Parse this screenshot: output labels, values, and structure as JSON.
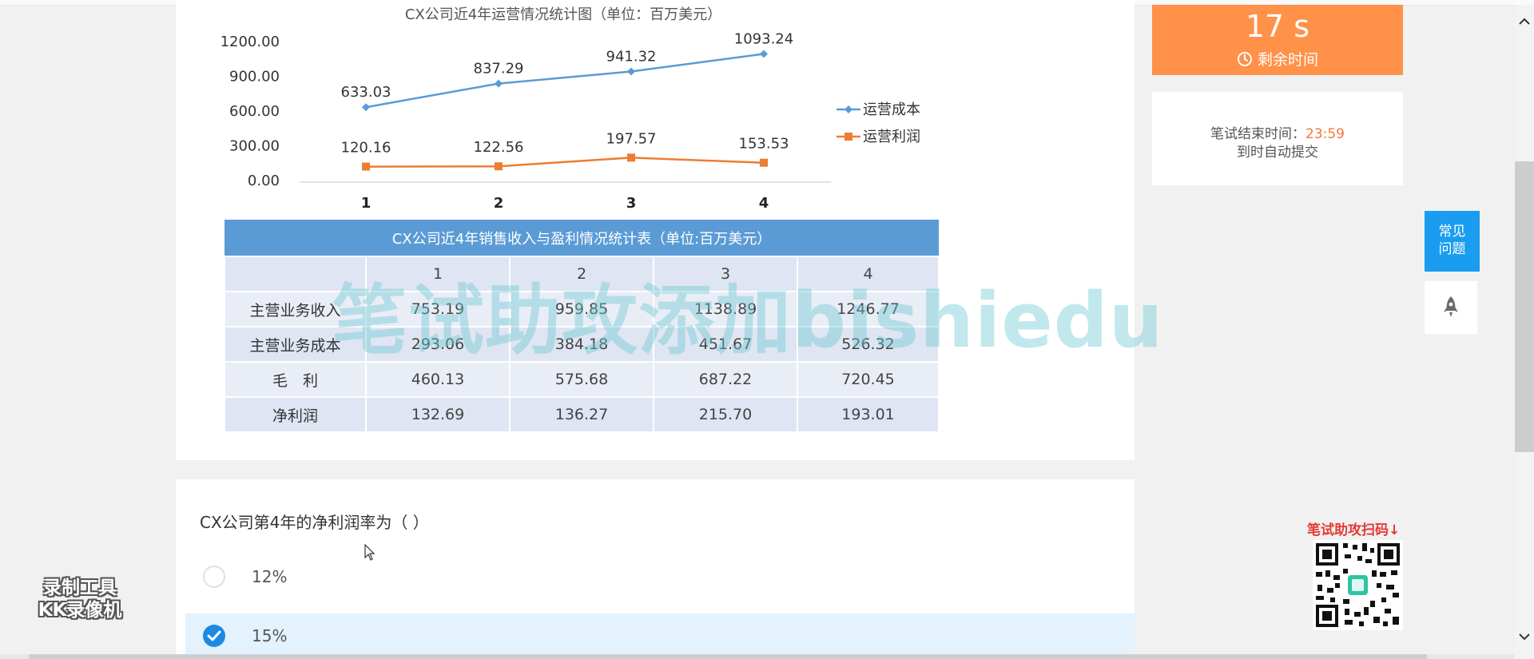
{
  "chart_data": {
    "type": "line",
    "title": "CX公司近4年运营情况统计图（单位：百万美元）",
    "categories": [
      "1",
      "2",
      "3",
      "4"
    ],
    "y_ticks": [
      "1200.00",
      "900.00",
      "600.00",
      "300.00",
      "0.00"
    ],
    "ylim": [
      0,
      1200
    ],
    "series": [
      {
        "name": "运营成本",
        "values": [
          633.03,
          837.29,
          941.32,
          1093.24
        ],
        "labels": [
          "633.03",
          "837.29",
          "941.32",
          "1093.24"
        ],
        "color": "#5b9bd5",
        "marker": "diamond"
      },
      {
        "name": "运营利润",
        "values": [
          120.16,
          122.56,
          197.57,
          153.53
        ],
        "labels": [
          "120.16",
          "122.56",
          "197.57",
          "153.53"
        ],
        "color": "#ed7d31",
        "marker": "square"
      }
    ],
    "legend_position": "right"
  },
  "table": {
    "caption": "CX公司近4年销售收入与盈利情况统计表（单位:百万美元）",
    "header": [
      "",
      "1",
      "2",
      "3",
      "4"
    ],
    "rows": [
      [
        "主营业务收入",
        "753.19",
        "959.85",
        "1138.89",
        "1246.77"
      ],
      [
        "主营业务成本",
        "293.06",
        "384.18",
        "451.67",
        "526.32"
      ],
      [
        "毛　利",
        "460.13",
        "575.68",
        "687.22",
        "720.45"
      ],
      [
        "净利润",
        "132.69",
        "136.27",
        "215.70",
        "193.01"
      ]
    ]
  },
  "watermark": "笔试助攻添加bishiedu",
  "question": {
    "text": "CX公司第4年的净利润率为（  ）",
    "options": [
      {
        "label": "12%",
        "selected": false
      },
      {
        "label": "15%",
        "selected": true
      }
    ]
  },
  "timer": {
    "value": "17 s",
    "label": "剩余时间",
    "end_label": "笔试结束时间：",
    "end_time": "23:59",
    "auto_submit": "到时自动提交"
  },
  "side": {
    "faq_line1": "常见",
    "faq_line2": "问题"
  },
  "promo": {
    "qr_title": "笔试助攻扫码↓"
  },
  "recorder": {
    "line1": "录制工具",
    "line2": "KK录像机"
  },
  "colors": {
    "timer_bg": "#ff9148",
    "accent_blue": "#1a9df0",
    "selected_bg": "#e3f2fd",
    "table_header": "#5b9bd5"
  }
}
